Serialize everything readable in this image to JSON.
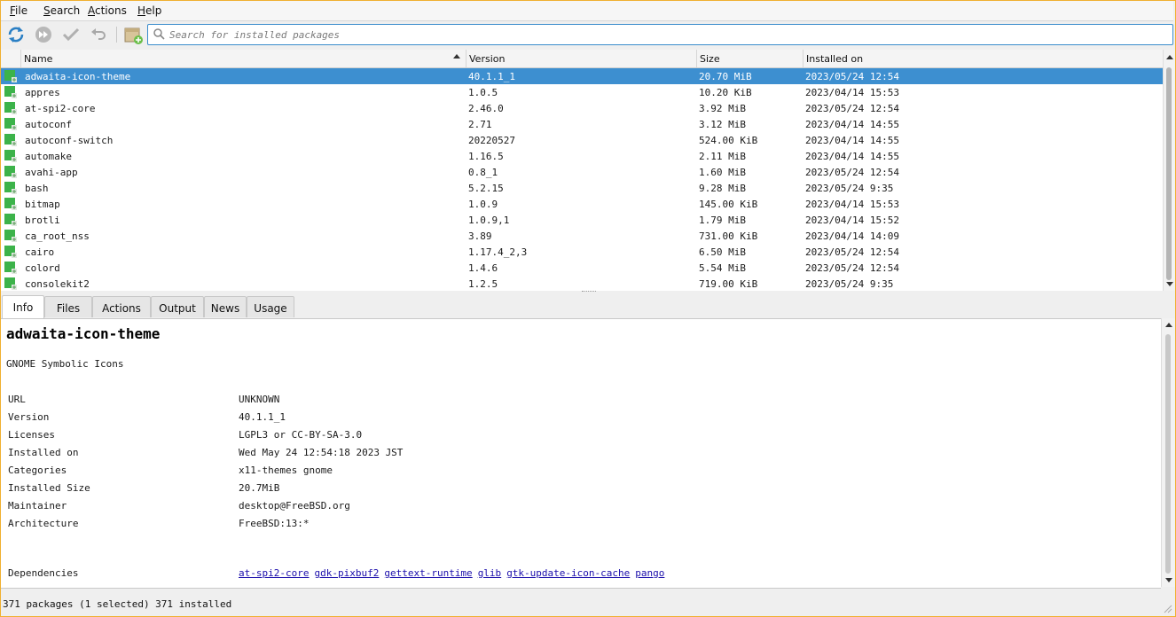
{
  "menubar": {
    "items": [
      {
        "pre": "",
        "u": "F",
        "post": "ile"
      },
      {
        "pre": "",
        "u": "S",
        "post": "earch"
      },
      {
        "pre": "",
        "u": "A",
        "post": "ctions"
      },
      {
        "pre": "",
        "u": "H",
        "post": "elp"
      }
    ]
  },
  "toolbar": {
    "icons": [
      "refresh-icon",
      "fast-forward-icon",
      "checkmark-icon",
      "undo-icon",
      "add-package-icon"
    ],
    "search_placeholder": "Search for installed packages"
  },
  "columns": [
    "Name",
    "Version",
    "Size",
    "Installed on"
  ],
  "packages": [
    {
      "name": "adwaita-icon-theme",
      "version": "40.1.1_1",
      "size": "20.70 MiB",
      "installed": "2023/05/24 12:54",
      "selected": true
    },
    {
      "name": "appres",
      "version": "1.0.5",
      "size": "10.20 KiB",
      "installed": "2023/04/14 15:53"
    },
    {
      "name": "at-spi2-core",
      "version": "2.46.0",
      "size": "3.92 MiB",
      "installed": "2023/05/24 12:54"
    },
    {
      "name": "autoconf",
      "version": "2.71",
      "size": "3.12 MiB",
      "installed": "2023/04/14 14:55"
    },
    {
      "name": "autoconf-switch",
      "version": "20220527",
      "size": "524.00 KiB",
      "installed": "2023/04/14 14:55"
    },
    {
      "name": "automake",
      "version": "1.16.5",
      "size": "2.11 MiB",
      "installed": "2023/04/14 14:55"
    },
    {
      "name": "avahi-app",
      "version": "0.8_1",
      "size": "1.60 MiB",
      "installed": "2023/05/24 12:54"
    },
    {
      "name": "bash",
      "version": "5.2.15",
      "size": "9.28 MiB",
      "installed": "2023/05/24 9:35"
    },
    {
      "name": "bitmap",
      "version": "1.0.9",
      "size": "145.00 KiB",
      "installed": "2023/04/14 15:53"
    },
    {
      "name": "brotli",
      "version": "1.0.9,1",
      "size": "1.79 MiB",
      "installed": "2023/04/14 15:52"
    },
    {
      "name": "ca_root_nss",
      "version": "3.89",
      "size": "731.00 KiB",
      "installed": "2023/04/14 14:09"
    },
    {
      "name": "cairo",
      "version": "1.17.4_2,3",
      "size": "6.50 MiB",
      "installed": "2023/05/24 12:54"
    },
    {
      "name": "colord",
      "version": "1.4.6",
      "size": "5.54 MiB",
      "installed": "2023/05/24 12:54"
    },
    {
      "name": "consolekit2",
      "version": "1.2.5",
      "size": "719.00 KiB",
      "installed": "2023/05/24 9:35"
    }
  ],
  "tabs": [
    "Info",
    "Files",
    "Actions",
    "Output",
    "News",
    "Usage"
  ],
  "active_tab": "Info",
  "info": {
    "title": "adwaita-icon-theme",
    "description": "GNOME Symbolic Icons",
    "fields": [
      {
        "key": "URL",
        "value": "UNKNOWN"
      },
      {
        "key": "Version",
        "value": "40.1.1_1"
      },
      {
        "key": "Licenses",
        "value": "LGPL3 or CC-BY-SA-3.0"
      },
      {
        "key": "Installed on",
        "value": "Wed May 24 12:54:18 2023 JST"
      },
      {
        "key": "Categories",
        "value": "x11-themes gnome"
      },
      {
        "key": "Installed Size",
        "value": "20.7MiB"
      },
      {
        "key": "Maintainer",
        "value": "desktop@FreeBSD.org"
      },
      {
        "key": "Architecture",
        "value": "FreeBSD:13:*"
      }
    ],
    "dependencies_label": "Dependencies",
    "dependencies": [
      "at-spi2-core",
      "gdk-pixbuf2",
      "gettext-runtime",
      "glib",
      "gtk-update-icon-cache",
      "pango"
    ]
  },
  "status": "371 packages (1 selected)  371 installed",
  "colors": {
    "selection": "#3d8fd0",
    "accent": "#3a8ccc",
    "link": "#1a0dab",
    "window_border": "#f0b030"
  }
}
